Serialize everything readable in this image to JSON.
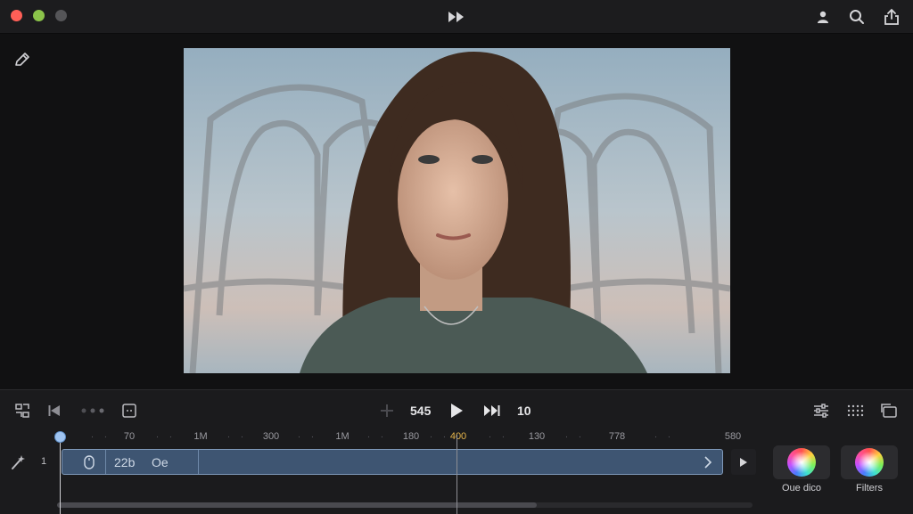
{
  "window": {
    "traffic_lights": {
      "close": "#ff5f57",
      "minimize": "#8bc34a",
      "zoom": "#555558"
    },
    "title_icon": "fast-forward-icon",
    "toolbar_icons": [
      "person-icon",
      "search-icon",
      "share-icon"
    ]
  },
  "viewer": {
    "tool_icon": "pen-icon"
  },
  "transport": {
    "left_icons": [
      "transform-icon",
      "rewind-icon",
      "more-dots-icon",
      "crop-icon"
    ],
    "add_icon": "plus-icon",
    "timecode_left": "545",
    "play_icon": "play-icon",
    "skip_icon": "skip-forward-icon",
    "timecode_right": "10",
    "right_icons": [
      "adjust-sliders-icon",
      "grid-icon",
      "aspect-icon"
    ]
  },
  "ruler": {
    "labels": [
      "70",
      "1M",
      "300",
      "1M",
      "180",
      "400",
      "130",
      "778",
      "580"
    ],
    "active_label": "400"
  },
  "timeline": {
    "track_icon": "magic-wand-icon",
    "track_number": "1",
    "clip_label_a": "22b",
    "clip_label_b": "Oe",
    "clip_color": "#3e5572",
    "scroll_fraction": 0.69
  },
  "effects": [
    {
      "label": "Oue dico",
      "icon": "color-wheel-icon"
    },
    {
      "label": "Filters",
      "icon": "color-wheel-icon"
    }
  ]
}
